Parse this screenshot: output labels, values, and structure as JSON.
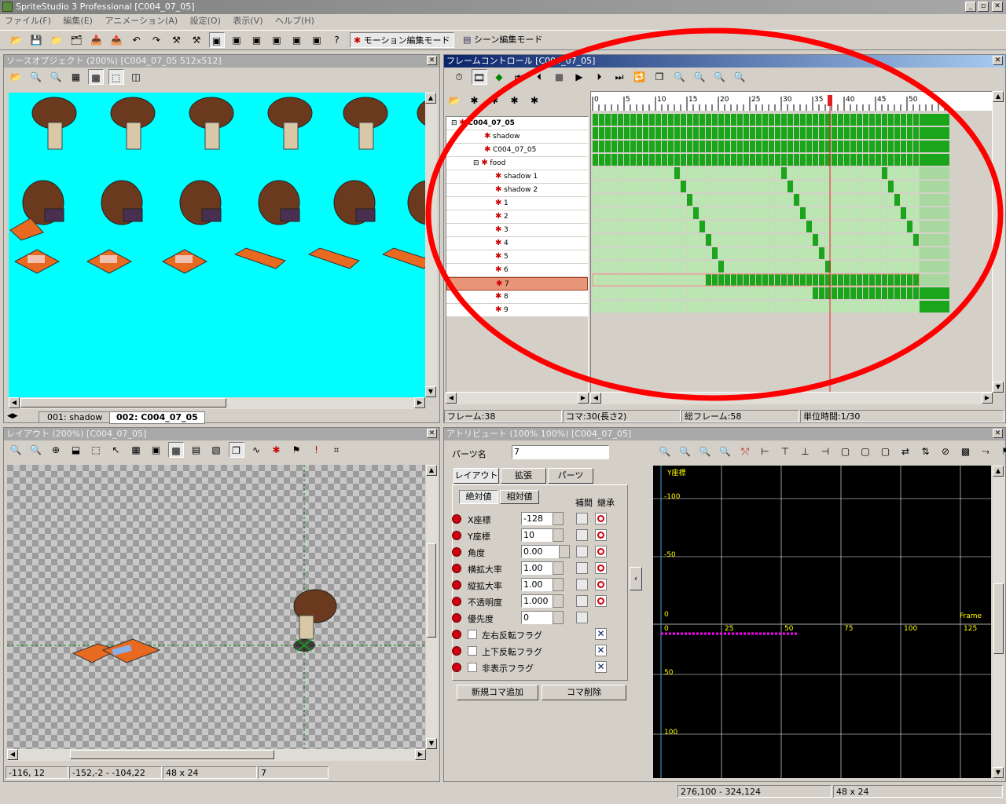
{
  "window": {
    "title": "SpriteStudio 3 Professional [C004_07_05]",
    "min": "_",
    "max": "▫",
    "close": "✕"
  },
  "menu": [
    "ファイル(F)",
    "編集(E)",
    "アニメーション(A)",
    "設定(O)",
    "表示(V)",
    "ヘルプ(H)"
  ],
  "toolbar": {
    "motion_mode": "モーション編集モード",
    "scene_mode": "シーン編集モード",
    "help": "?"
  },
  "source_panel": {
    "title": "ソースオブジェクト (200%) [C004_07_05  512x512]",
    "tabs": [
      "001: shadow",
      "002: C004_07_05"
    ],
    "bg": "#00ffff"
  },
  "frame_panel": {
    "title": "フレームコントロール [C004_07_05]",
    "ruler": [
      "0",
      "5",
      "10",
      "15",
      "20",
      "25",
      "30",
      "35",
      "40",
      "45",
      "50"
    ],
    "tree": [
      {
        "label": "C004_07_05",
        "indent": 0,
        "bold": true
      },
      {
        "label": "shadow",
        "indent": 3
      },
      {
        "label": "C004_07_05",
        "indent": 3
      },
      {
        "label": "food",
        "indent": 2
      },
      {
        "label": "shadow 1",
        "indent": 4
      },
      {
        "label": "shadow 2",
        "indent": 4
      },
      {
        "label": "1",
        "indent": 4
      },
      {
        "label": "2",
        "indent": 4
      },
      {
        "label": "3",
        "indent": 4
      },
      {
        "label": "4",
        "indent": 4
      },
      {
        "label": "5",
        "indent": 4
      },
      {
        "label": "6",
        "indent": 4
      },
      {
        "label": "7",
        "indent": 4,
        "selected": true
      },
      {
        "label": "8",
        "indent": 4
      },
      {
        "label": "9",
        "indent": 4
      }
    ],
    "status": {
      "frame": "フレーム:38",
      "koma": "コマ:30(長さ2)",
      "total": "総フレーム:58",
      "unit": "単位時間:1/30"
    },
    "current_frame": 38,
    "total_frames": 58
  },
  "layout_panel": {
    "title": "レイアウト (200%) [C004_07_05]",
    "status": [
      "-116, 12",
      "-152,-2 - -104,22",
      "48 x 24",
      "7"
    ]
  },
  "attr_panel": {
    "title": "アトリビュート (100% 100%) [C004_07_05]",
    "parts_label": "パーツ名",
    "parts_value": "7",
    "tabs": [
      "レイアウト",
      "拡張",
      "パーツ"
    ],
    "subtabs": [
      "絶対値",
      "相対値"
    ],
    "col_interp": "補間",
    "col_inherit": "継承",
    "rows": [
      {
        "label": "X座標",
        "value": "-128"
      },
      {
        "label": "Y座標",
        "value": "10"
      },
      {
        "label": "角度",
        "value": "0.00"
      },
      {
        "label": "横拡大率",
        "value": "1.00"
      },
      {
        "label": "縦拡大率",
        "value": "1.00"
      },
      {
        "label": "不透明度",
        "value": "1.000"
      },
      {
        "label": "優先度",
        "value": "0"
      }
    ],
    "flags": [
      "左右反転フラグ",
      "上下反転フラグ",
      "非表示フラグ"
    ],
    "add_button": "新規コマ追加",
    "del_button": "コマ削除",
    "graph": {
      "title": "Y座標",
      "y_labels": [
        "-100",
        "-50",
        "0",
        "50",
        "100"
      ],
      "x_labels": [
        "0",
        "25",
        "50",
        "75",
        "100",
        "125"
      ],
      "frame_label": "Frame"
    }
  },
  "statusbar": [
    "276,100 - 324,124",
    "48 x 24"
  ],
  "colors": {
    "track_dark": "#1aa51a",
    "track_light": "#b8e8b0",
    "highlight": "#ff0000"
  }
}
